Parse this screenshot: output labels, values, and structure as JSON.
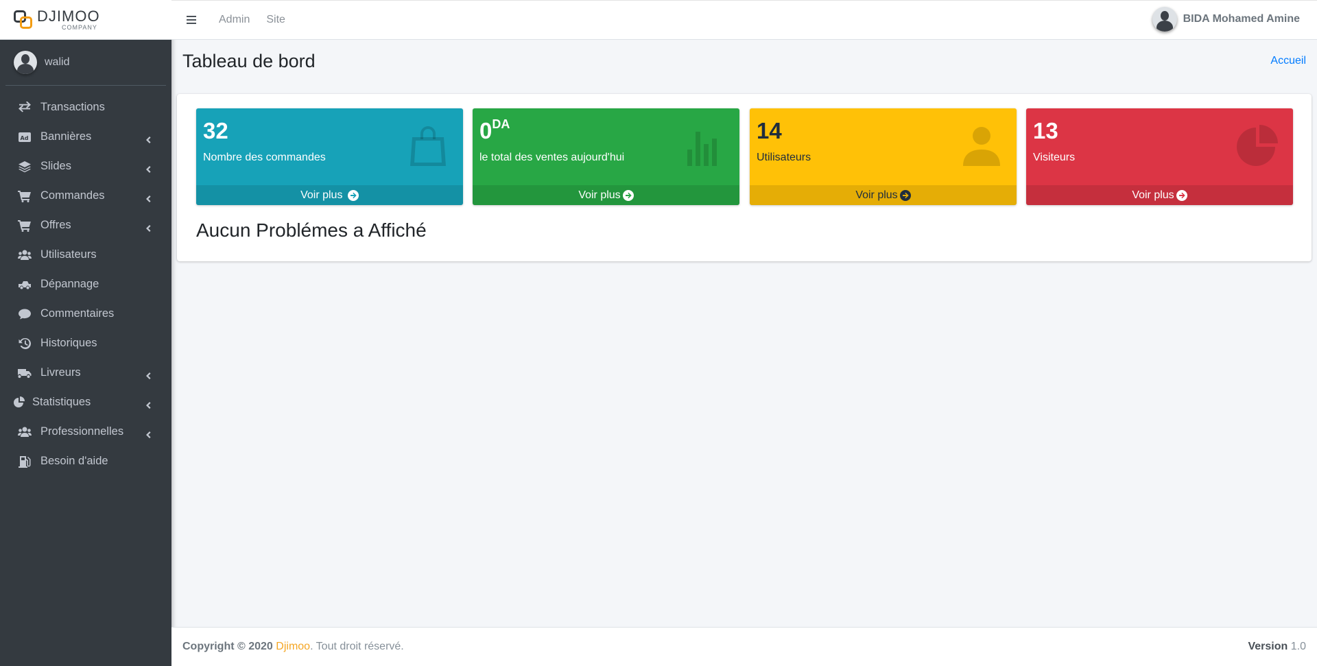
{
  "brand": {
    "name": "DJIMOO",
    "subtitle": "COMPANY"
  },
  "sidebar": {
    "user": "walid",
    "items": [
      {
        "label": "Transactions",
        "icon": "exchange-icon",
        "expandable": false
      },
      {
        "label": "Bannières",
        "icon": "ad-icon",
        "expandable": true
      },
      {
        "label": "Slides",
        "icon": "layers-icon",
        "expandable": true
      },
      {
        "label": "Commandes",
        "icon": "cart-icon",
        "expandable": true
      },
      {
        "label": "Offres",
        "icon": "cart-icon",
        "expandable": true
      },
      {
        "label": "Utilisateurs",
        "icon": "users-icon",
        "expandable": false
      },
      {
        "label": "Dépannage",
        "icon": "tow-truck-icon",
        "expandable": false
      },
      {
        "label": "Commentaires",
        "icon": "comment-icon",
        "expandable": false
      },
      {
        "label": "Historiques",
        "icon": "history-icon",
        "expandable": false
      },
      {
        "label": "Livreurs",
        "icon": "truck-icon",
        "expandable": true
      },
      {
        "label": "Statistiques",
        "icon": "pie-chart-icon",
        "expandable": true
      },
      {
        "label": "Professionnelles",
        "icon": "users-icon",
        "expandable": true
      },
      {
        "label": "Besoin d'aide",
        "icon": "gas-pump-icon",
        "expandable": false
      }
    ]
  },
  "topbar": {
    "links": [
      "Admin",
      "Site"
    ],
    "user_name": "BIDA Mohamed Amine"
  },
  "content": {
    "title": "Tableau de bord",
    "breadcrumb": "Accueil",
    "message": "Aucun Problémes a Affiché"
  },
  "stats": [
    {
      "value": "32",
      "suffix": "",
      "label": "Nombre des commandes",
      "footer": "Voir plus",
      "icon": "shopping-bag-icon",
      "color": "#17a2b8"
    },
    {
      "value": "0",
      "suffix": "DA",
      "label": "le total des ventes aujourd'hui",
      "footer": "Voir plus",
      "icon": "bar-chart-icon",
      "color": "#28a745"
    },
    {
      "value": "14",
      "suffix": "",
      "label": "Utilisateurs",
      "footer": "Voir plus",
      "icon": "user-icon",
      "color": "#ffc107"
    },
    {
      "value": "13",
      "suffix": "",
      "label": "Visiteurs",
      "footer": "Voir plus",
      "icon": "pie-chart-icon",
      "color": "#dc3545"
    }
  ],
  "footer": {
    "copyright": "Copyright © 2020",
    "brand": "Djimoo",
    "rights": ". Tout droit réservé.",
    "version_label": "Version",
    "version": "1.0"
  }
}
